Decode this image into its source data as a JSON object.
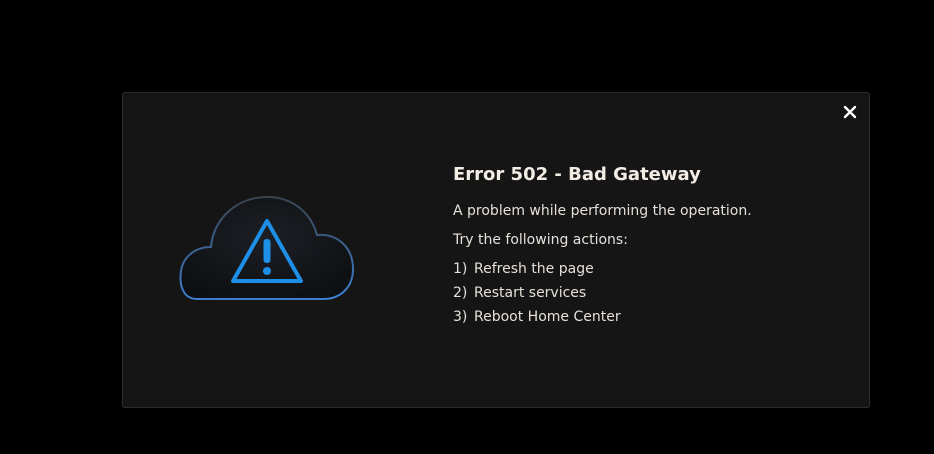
{
  "dialog": {
    "close_icon": "close-icon",
    "illustration_icon": "cloud-warning-icon",
    "title": "Error 502 - Bad Gateway",
    "message": "A problem while performing the operation.",
    "instructions": "Try the following actions:",
    "actions": [
      {
        "num": "1)",
        "label": "Refresh the page"
      },
      {
        "num": "2)",
        "label": "Restart services"
      },
      {
        "num": "3)",
        "label": "Reboot Home Center"
      }
    ],
    "colors": {
      "background": "#000000",
      "panel": "#151515",
      "text": "#ece6e0",
      "accent": "#1e8fe6"
    }
  }
}
